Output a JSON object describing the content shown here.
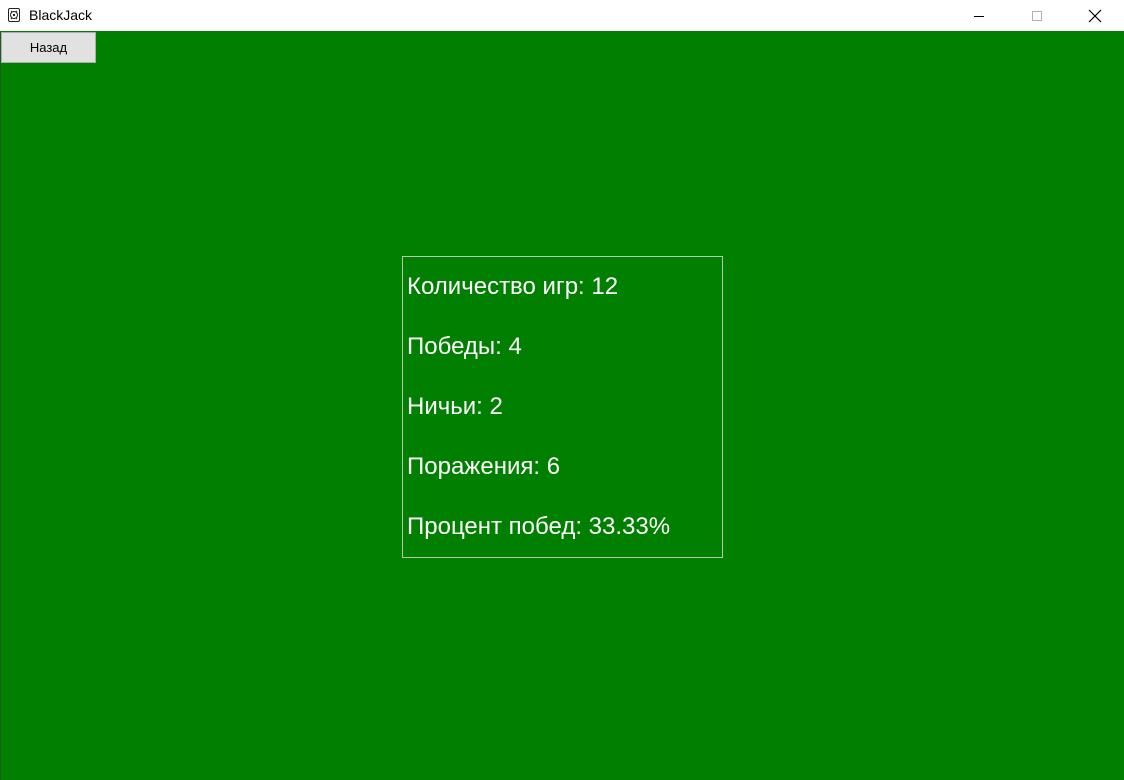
{
  "window": {
    "title": "BlackJack",
    "icon": "gear-card-icon",
    "controls": {
      "minimize_icon": "minimize-icon",
      "maximize_icon": "maximize-icon",
      "close_icon": "close-icon"
    }
  },
  "toolbar": {
    "back_label": "Назад"
  },
  "stats": {
    "games": "Количество игр: 12",
    "wins": "Победы: 4",
    "draws": "Ничьи: 2",
    "losses": "Поражения: 6",
    "win_rate": "Процент побед: 33.33%"
  },
  "colors": {
    "background": "#007f00",
    "text": "#ffffff"
  }
}
